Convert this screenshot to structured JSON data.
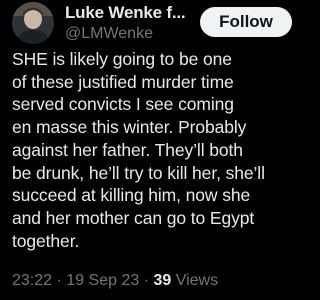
{
  "author": {
    "display_name": "Luke Wenke f...",
    "handle": "@LMWenke"
  },
  "follow_button": {
    "label": "Follow"
  },
  "tweet": {
    "lines": [
      "SHE is likely going to be one",
      "of these justified murder time",
      "served convicts I see coming",
      "en masse this winter.  Probably",
      "against her father.  They’ll both",
      "be drunk, he’ll try to kill her, she’ll",
      "succeed at killing him, now she",
      "and her mother can go to Egypt",
      "together."
    ]
  },
  "meta": {
    "time": "23:22",
    "separator": "·",
    "date": "19 Sep 23",
    "views_count": "39",
    "views_label": "Views"
  },
  "colors": {
    "background": "#000000",
    "text_primary": "#e7e9ea",
    "text_secondary": "#71767b",
    "button_bg": "#eff3f4"
  },
  "icons": {
    "avatar": "profile-photo"
  }
}
